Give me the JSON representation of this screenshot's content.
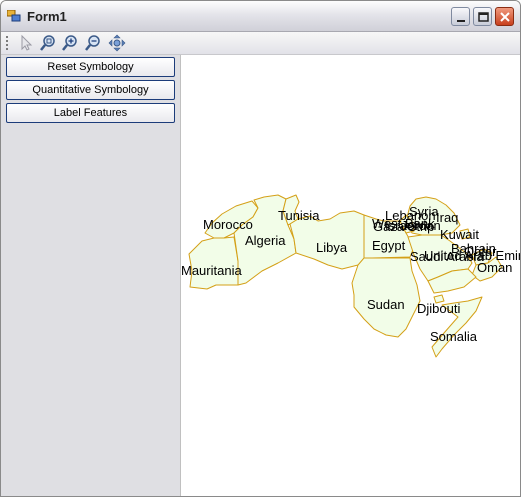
{
  "window": {
    "title": "Form1"
  },
  "sidebar": {
    "buttons": {
      "reset": "Reset Symbology",
      "quantitative": "Quantitative Symbology",
      "label": "Label Features"
    }
  },
  "map": {
    "country_fill": "#f2fde8",
    "border_color": "#d4a017",
    "labels": {
      "morocco": "Morocco",
      "tunisia": "Tunisia",
      "algeria": "Algeria",
      "libya": "Libya",
      "mauritania": "Mauritania",
      "lebanon": "Lebanon",
      "syria": "Syria",
      "iraq": "Iraq",
      "west_bank": "West Bank",
      "gaza_strip": "Gaza Strip",
      "israel": "Israel",
      "jordan": "Jordan",
      "egypt": "Egypt",
      "kuwait": "Kuwait",
      "bahrain": "Bahrain",
      "qatar": "Qatar",
      "uae": "United Arab Emirates",
      "saudi_arabia": "Saudi Arabia",
      "oman": "Oman",
      "sudan": "Sudan",
      "djibouti": "Djibouti",
      "somalia": "Somalia"
    }
  }
}
